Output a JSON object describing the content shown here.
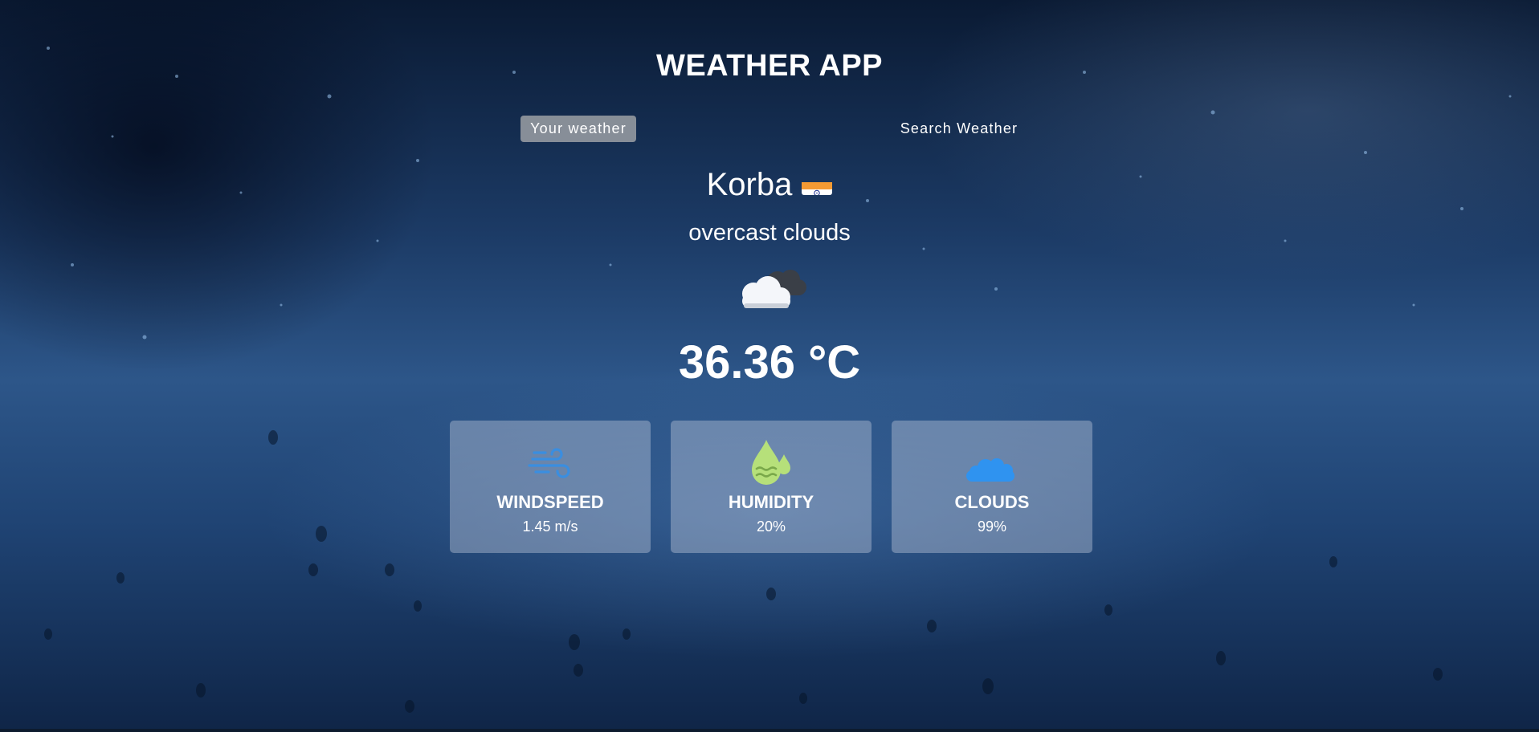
{
  "app": {
    "title": "WEATHER APP"
  },
  "tabs": [
    {
      "label": "Your weather",
      "active": true
    },
    {
      "label": "Search Weather",
      "active": false
    }
  ],
  "location": {
    "city": "Korba",
    "flag_icon": "india-flag-icon"
  },
  "weather": {
    "description": "overcast clouds",
    "icon": "overcast-clouds-icon",
    "temperature": "36.36 °C"
  },
  "stats": [
    {
      "label": "WINDSPEED",
      "value": "1.45 m/s",
      "icon": "wind-icon",
      "icon_color": "#3a8ee0"
    },
    {
      "label": "HUMIDITY",
      "value": "20%",
      "icon": "humidity-droplet-icon",
      "icon_color": "#b6e07a"
    },
    {
      "label": "CLOUDS",
      "value": "99%",
      "icon": "cloud-icon",
      "icon_color": "#2f93f0"
    }
  ],
  "colors": {
    "active_tab_bg": "#b4b4b4",
    "card_bg": "#bec8dc",
    "text": "#ffffff",
    "background_blue": "#2d5689"
  }
}
